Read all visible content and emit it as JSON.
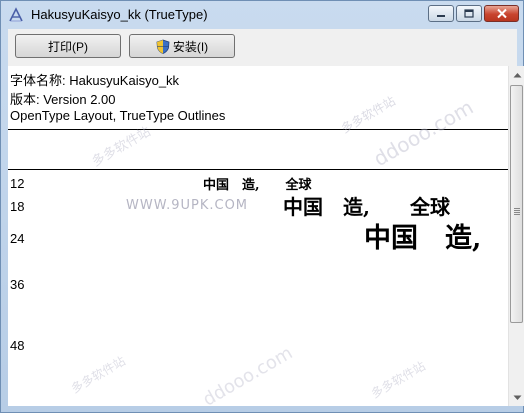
{
  "window": {
    "title": "HakusyuKaisyo_kk (TrueType)",
    "close_color": "#c8442f"
  },
  "toolbar": {
    "print_label": "打印(P)",
    "install_label": "安装(I)"
  },
  "font_info": {
    "name_line": "字体名称: HakusyuKaisyo_kk",
    "version_line": "版本: Version 2.00",
    "type_line": "OpenType Layout, TrueType Outlines"
  },
  "samples": {
    "text": "中国　造,　　全球",
    "sizes": [
      "12",
      "18",
      "24",
      "36",
      "48"
    ],
    "row12": "中国　造,　　全球",
    "row18": "中国　造,　　全球",
    "row24": "中国　造,"
  },
  "watermark": {
    "url": "WWW.9UPK.COM",
    "site_text": "多多软件站",
    "domain_text": "ddooo.com"
  }
}
